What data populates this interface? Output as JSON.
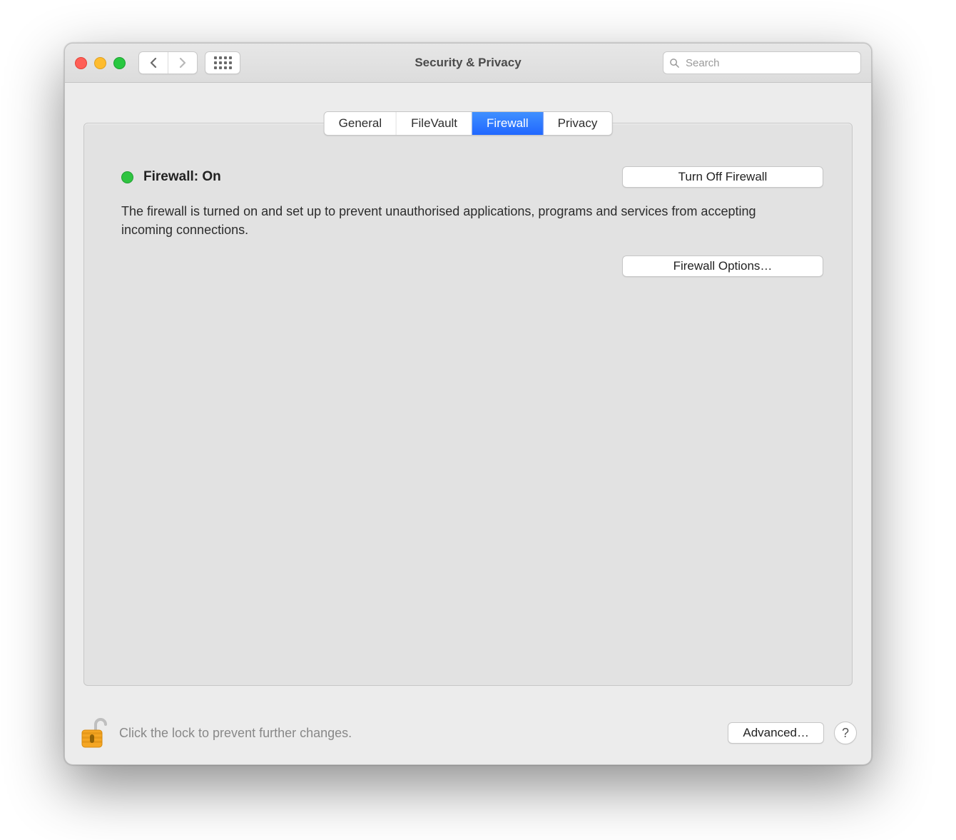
{
  "window": {
    "title": "Security & Privacy"
  },
  "search": {
    "placeholder": "Search"
  },
  "tabs": {
    "general": "General",
    "filevault": "FileVault",
    "firewall": "Firewall",
    "privacy": "Privacy"
  },
  "firewall": {
    "status_label": "Firewall: On",
    "turn_off_label": "Turn Off Firewall",
    "description": "The firewall is turned on and set up to prevent unauthorised applications, programs and services from accepting incoming connections.",
    "options_label": "Firewall Options…"
  },
  "footer": {
    "lock_hint": "Click the lock to prevent further changes.",
    "advanced_label": "Advanced…",
    "help_label": "?"
  }
}
